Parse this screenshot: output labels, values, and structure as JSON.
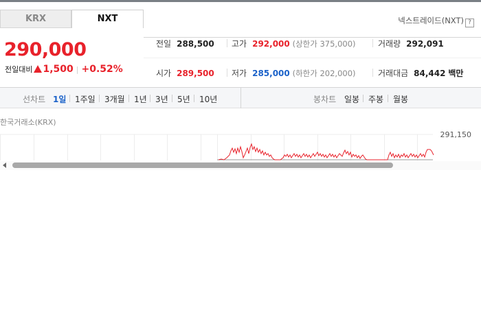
{
  "tabs": [
    {
      "label": "KRX",
      "active": false
    },
    {
      "label": "NXT",
      "active": true
    }
  ],
  "nxt_link": "넥스트레이드(NXT)",
  "nxt_help_icon": "?",
  "price": {
    "current": "290,000",
    "change_label": "전일대비",
    "change_amount": "1,500",
    "change_percent": "+0.52%",
    "direction": "up"
  },
  "stats": {
    "prev_label": "전일",
    "prev_value": "288,500",
    "high_label": "고가",
    "high_value": "292,000",
    "upper_limit": "(상한가 375,000)",
    "volume_label": "거래량",
    "volume_value": "292,091",
    "open_label": "시가",
    "open_value": "289,500",
    "low_label": "저가",
    "low_value": "285,000",
    "lower_limit": "(하한가 202,000)",
    "amount_label": "거래대금",
    "amount_value": "84,442",
    "amount_unit": "백만"
  },
  "line_chart_tabs": {
    "title": "선차트",
    "items": [
      "1일",
      "1주일",
      "3개월",
      "1년",
      "3년",
      "5년",
      "10년"
    ],
    "active": "1일"
  },
  "candle_chart_tabs": {
    "title": "봉차트",
    "items": [
      "일봉",
      "주봉",
      "월봉"
    ]
  },
  "chart": {
    "exchange_label": "한국거래소(KRX)",
    "y_top_label": "291,150"
  },
  "colors": {
    "up": "#e8222b",
    "down": "#1b62c9",
    "active_tab": "#1b62c9"
  }
}
